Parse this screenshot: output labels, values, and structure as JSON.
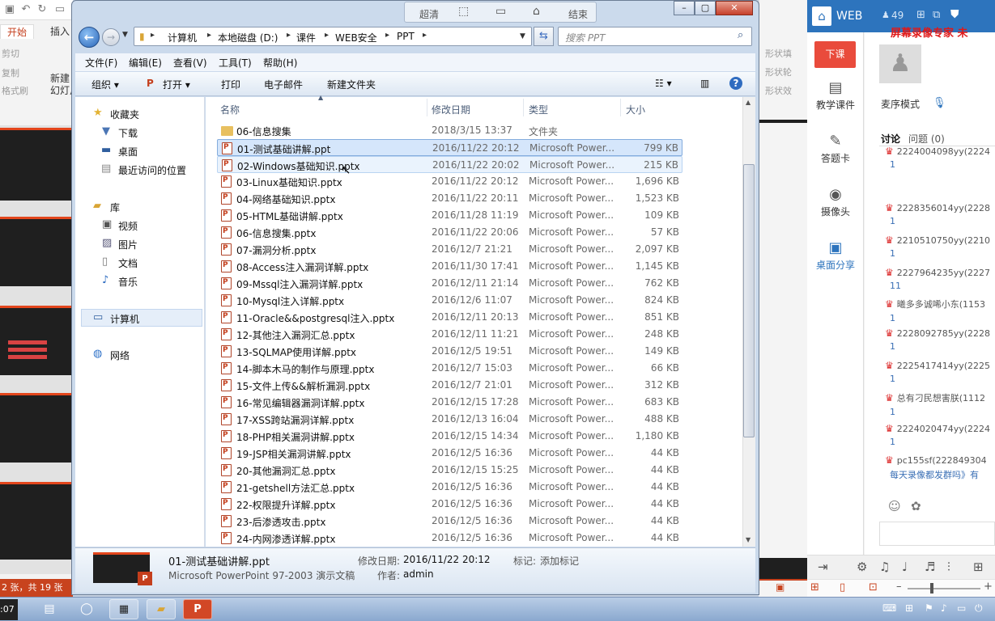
{
  "ppt": {
    "tabs": [
      "开始",
      "插入"
    ],
    "commands": [
      "剪切",
      "复制",
      "格式刷"
    ],
    "new_slide": "新建\n幻灯片",
    "status": "2 张，共 19 张",
    "right_shape_items": [
      "形状填",
      "形状轮",
      "形状效"
    ]
  },
  "viewer_tools": [
    "超清",
    "结束"
  ],
  "explorer": {
    "breadcrumb": [
      "计算机",
      "本地磁盘 (D:)",
      "课件",
      "WEB安全",
      "PPT"
    ],
    "search_placeholder": "搜索 PPT",
    "menu": [
      "文件(F)",
      "编辑(E)",
      "查看(V)",
      "工具(T)",
      "帮助(H)"
    ],
    "toolbar": [
      "组织",
      "打开",
      "打印",
      "电子邮件",
      "新建文件夹"
    ],
    "nav": {
      "favorites": "收藏夹",
      "fav_items": [
        "下载",
        "桌面",
        "最近访问的位置"
      ],
      "libraries": "库",
      "lib_items": [
        "视频",
        "图片",
        "文档",
        "音乐"
      ],
      "computer": "计算机",
      "network": "网络"
    },
    "columns": [
      "名称",
      "修改日期",
      "类型",
      "大小"
    ],
    "files": [
      {
        "name": "06-信息搜集",
        "date": "2018/3/15 13:37",
        "type": "文件夹",
        "size": "",
        "folder": true
      },
      {
        "name": "01-测试基础讲解.ppt",
        "date": "2016/11/22 20:12",
        "type": "Microsoft Power...",
        "size": "799 KB"
      },
      {
        "name": "02-Windows基础知识.pptx",
        "date": "2016/11/22 20:02",
        "type": "Microsoft Power...",
        "size": "215 KB"
      },
      {
        "name": "03-Linux基础知识.pptx",
        "date": "2016/11/22 20:12",
        "type": "Microsoft Power...",
        "size": "1,696 KB"
      },
      {
        "name": "04-网络基础知识.pptx",
        "date": "2016/11/22 20:11",
        "type": "Microsoft Power...",
        "size": "1,523 KB"
      },
      {
        "name": "05-HTML基础讲解.pptx",
        "date": "2016/11/28 11:19",
        "type": "Microsoft Power...",
        "size": "109 KB"
      },
      {
        "name": "06-信息搜集.pptx",
        "date": "2016/11/22 20:06",
        "type": "Microsoft Power...",
        "size": "57 KB"
      },
      {
        "name": "07-漏洞分析.pptx",
        "date": "2016/12/7 21:21",
        "type": "Microsoft Power...",
        "size": "2,097 KB"
      },
      {
        "name": "08-Access注入漏洞详解.pptx",
        "date": "2016/11/30 17:41",
        "type": "Microsoft Power...",
        "size": "1,145 KB"
      },
      {
        "name": "09-Mssql注入漏洞详解.pptx",
        "date": "2016/12/11 21:14",
        "type": "Microsoft Power...",
        "size": "762 KB"
      },
      {
        "name": "10-Mysql注入详解.pptx",
        "date": "2016/12/6 11:07",
        "type": "Microsoft Power...",
        "size": "824 KB"
      },
      {
        "name": "11-Oracle&&postgresql注入.pptx",
        "date": "2016/12/11 20:13",
        "type": "Microsoft Power...",
        "size": "851 KB"
      },
      {
        "name": "12-其他注入漏洞汇总.pptx",
        "date": "2016/12/11 11:21",
        "type": "Microsoft Power...",
        "size": "248 KB"
      },
      {
        "name": "13-SQLMAP使用详解.pptx",
        "date": "2016/12/5 19:51",
        "type": "Microsoft Power...",
        "size": "149 KB"
      },
      {
        "name": "14-脚本木马的制作与原理.pptx",
        "date": "2016/12/7 15:03",
        "type": "Microsoft Power...",
        "size": "66 KB"
      },
      {
        "name": "15-文件上传&&解析漏洞.pptx",
        "date": "2016/12/7 21:01",
        "type": "Microsoft Power...",
        "size": "312 KB"
      },
      {
        "name": "16-常见编辑器漏洞详解.pptx",
        "date": "2016/12/15 17:28",
        "type": "Microsoft Power...",
        "size": "683 KB"
      },
      {
        "name": "17-XSS跨站漏洞详解.pptx",
        "date": "2016/12/13 16:04",
        "type": "Microsoft Power...",
        "size": "488 KB"
      },
      {
        "name": "18-PHP相关漏洞讲解.pptx",
        "date": "2016/12/15 14:34",
        "type": "Microsoft Power...",
        "size": "1,180 KB"
      },
      {
        "name": "19-JSP相关漏洞讲解.pptx",
        "date": "2016/12/5 16:36",
        "type": "Microsoft Power...",
        "size": "44 KB"
      },
      {
        "name": "20-其他漏洞汇总.pptx",
        "date": "2016/12/15 15:25",
        "type": "Microsoft Power...",
        "size": "44 KB"
      },
      {
        "name": "21-getshell方法汇总.pptx",
        "date": "2016/12/5 16:36",
        "type": "Microsoft Power...",
        "size": "44 KB"
      },
      {
        "name": "22-权限提升详解.pptx",
        "date": "2016/12/5 16:36",
        "type": "Microsoft Power...",
        "size": "44 KB"
      },
      {
        "name": "23-后渗透攻击.pptx",
        "date": "2016/12/5 16:36",
        "type": "Microsoft Power...",
        "size": "44 KB"
      },
      {
        "name": "24-内网渗透详解.pptx",
        "date": "2016/12/5 16:36",
        "type": "Microsoft Power...",
        "size": "44 KB"
      }
    ],
    "details": {
      "name": "01-测试基础讲解.ppt",
      "type": "Microsoft PowerPoint 97-2003 演示文稿",
      "modified_label": "修改日期:",
      "modified": "2016/11/22 20:12",
      "tags_label": "标记:",
      "tags": "添加标记",
      "author_label": "作者:",
      "author": "admin"
    }
  },
  "live": {
    "title": "WEB",
    "count": "49",
    "banner": "屏幕录像专家  未",
    "leave": "下课",
    "nav": [
      "教学课件",
      "答题卡",
      "摄像头",
      "桌面分享"
    ],
    "mode": "麦序模式",
    "tabs": [
      "讨论",
      "问题 (0)"
    ],
    "chat": [
      {
        "user": "2224004098yy(2224",
        "msg": "1"
      },
      {
        "user": "2228356014yy(2228",
        "msg": "1"
      },
      {
        "user": "2210510750yy(2210",
        "msg": "1"
      },
      {
        "user": "2227964235yy(2227",
        "msg": "11"
      },
      {
        "user": "曦多多诚唏小东(1153",
        "msg": "1"
      },
      {
        "user": "2228092785yy(2228",
        "msg": "1"
      },
      {
        "user": "2225417414yy(2225",
        "msg": "1"
      },
      {
        "user": "总有刁民想害朕(1112",
        "msg": "1"
      },
      {
        "user": "2224020474yy(2224",
        "msg": "1"
      },
      {
        "user": "pc155sf(222849304",
        "msg": "每天录像都发群吗》有"
      }
    ]
  },
  "taskbar": {
    "clock": ":07"
  }
}
